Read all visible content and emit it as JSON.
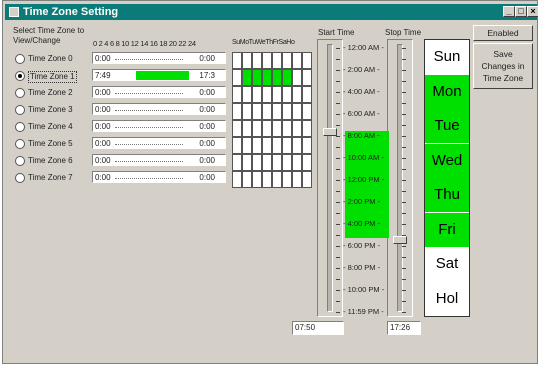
{
  "window": {
    "title": "Time Zone Setting"
  },
  "header": {
    "select_label": "Select Time Zone to View/Change",
    "hour_ticks": "0  2  4  6  8 10 12 14 16 18 20 22 24",
    "day_header": "SuMoTuWeThFrSaHo"
  },
  "zones": [
    {
      "label": "Time Zone 0",
      "start": "0:00",
      "end": "0:00",
      "selected": false,
      "fill": null
    },
    {
      "label": "Time Zone 1",
      "start": "7:49",
      "end": "17:3",
      "selected": true,
      "fill": [
        7.8,
        17.5
      ]
    },
    {
      "label": "Time Zone 2",
      "start": "0:00",
      "end": "0:00",
      "selected": false,
      "fill": null
    },
    {
      "label": "Time Zone 3",
      "start": "0:00",
      "end": "0:00",
      "selected": false,
      "fill": null
    },
    {
      "label": "Time Zone 4",
      "start": "0:00",
      "end": "0:00",
      "selected": false,
      "fill": null
    },
    {
      "label": "Time Zone 5",
      "start": "0:00",
      "end": "0:00",
      "selected": false,
      "fill": null
    },
    {
      "label": "Time Zone 6",
      "start": "0:00",
      "end": "0:00",
      "selected": false,
      "fill": null
    },
    {
      "label": "Time Zone 7",
      "start": "0:00",
      "end": "0:00",
      "selected": false,
      "fill": null
    }
  ],
  "day_grid_active": {
    "row": 1,
    "cols": [
      1,
      2,
      3,
      4,
      5
    ]
  },
  "sliders": {
    "start_label": "Start Time",
    "stop_label": "Stop Time",
    "start_value": "07:50",
    "stop_value": "17:26",
    "start_fraction": 0.33,
    "stop_fraction": 0.73,
    "active_range_hours": [
      7.8,
      17.5
    ]
  },
  "time_scale": [
    "12:00 AM",
    "2:00 AM",
    "4:00 AM",
    "6:00 AM",
    "8:00 AM",
    "10:00 AM",
    "12:00 PM",
    "2:00 PM",
    "4:00 PM",
    "6:00 PM",
    "8:00 PM",
    "10:00 PM",
    "11:59 PM"
  ],
  "days": [
    {
      "name": "Sun",
      "active": false
    },
    {
      "name": "Mon",
      "active": true
    },
    {
      "name": "Tue",
      "active": true
    },
    {
      "name": "Wed",
      "active": true
    },
    {
      "name": "Thu",
      "active": true
    },
    {
      "name": "Fri",
      "active": true
    },
    {
      "name": "Sat",
      "active": false
    },
    {
      "name": "Hol",
      "active": false
    }
  ],
  "buttons": {
    "enabled": "Enabled",
    "save": "Save Changes in Time Zone"
  },
  "colors": {
    "title_bar": "#0a7b78",
    "active": "#00e000",
    "face": "#d4d0c8"
  }
}
